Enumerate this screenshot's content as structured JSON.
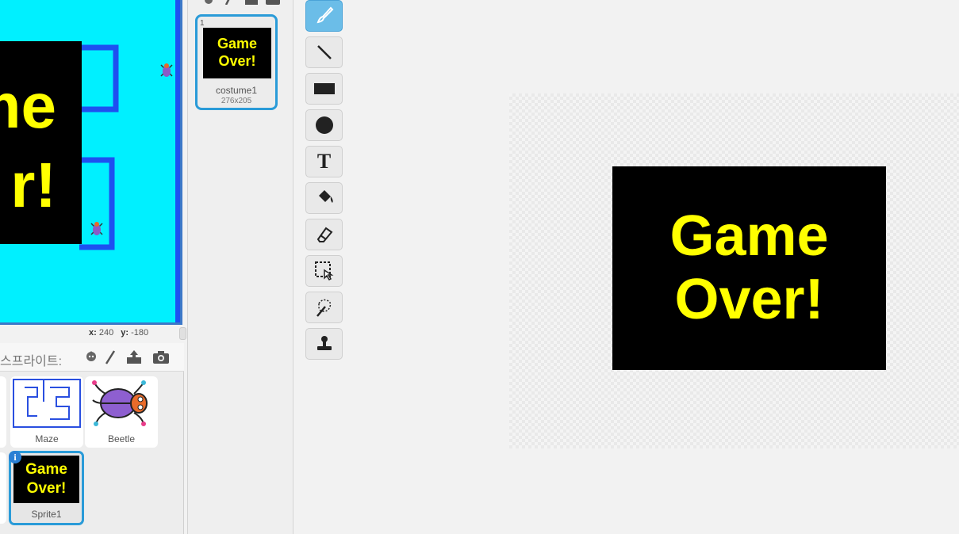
{
  "stage": {
    "overlay_lines": [
      "me",
      "r!"
    ]
  },
  "coords": {
    "x_label": "x:",
    "x_value": "240",
    "y_label": "y:",
    "y_value": "-180"
  },
  "sprites": {
    "label": "스프라이트:",
    "items": [
      {
        "name": "Maze"
      },
      {
        "name": "Beetle"
      },
      {
        "name": "Sprite1",
        "thumb_lines": [
          "Game",
          "Over!"
        ]
      }
    ],
    "info_badge": "i"
  },
  "costumes": {
    "items": [
      {
        "number": "1",
        "name": "costume1",
        "size": "276x205",
        "thumb_lines": [
          "Game",
          "Over!"
        ]
      }
    ]
  },
  "tools": [
    {
      "name": "brush-icon",
      "active": true
    },
    {
      "name": "line-icon"
    },
    {
      "name": "rectangle-icon"
    },
    {
      "name": "ellipse-icon"
    },
    {
      "name": "text-icon",
      "glyph": "T"
    },
    {
      "name": "fill-icon"
    },
    {
      "name": "eraser-icon"
    },
    {
      "name": "select-icon"
    },
    {
      "name": "remove-background-icon"
    },
    {
      "name": "stamp-icon"
    }
  ],
  "canvas": {
    "costume_lines": [
      "Game",
      "Over!"
    ]
  },
  "colors": {
    "stage_bg": "#00f0ff",
    "maze_wall": "#1e50f0",
    "text_yellow": "#ffff00",
    "selection_blue": "#2a9bd8"
  }
}
